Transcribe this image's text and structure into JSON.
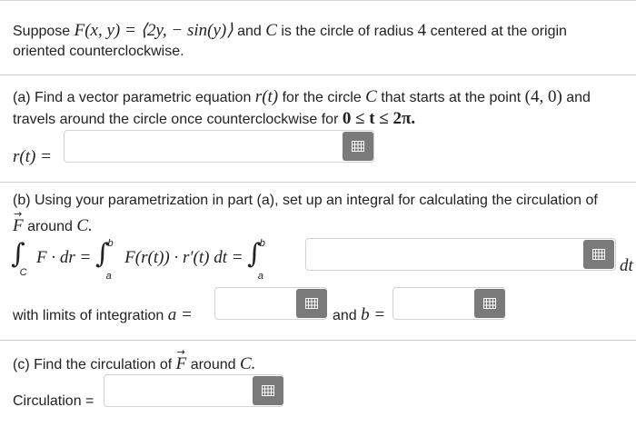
{
  "problem": {
    "intro_1": "Suppose",
    "field_expr": "F(x, y) = ⟨2y, − sin(y)⟩",
    "intro_2": "and",
    "curve": "C",
    "intro_3": "is the circle of radius",
    "radius": "4",
    "intro_4": "centered at the origin",
    "intro_line2": "oriented counterclockwise."
  },
  "part_a": {
    "text_1": "(a) Find a vector parametric equation",
    "r_t": "r(t)",
    "text_2": "for the circle",
    "text_3": "that starts at the point",
    "point": "(4, 0)",
    "text_4": "and",
    "line2": "travels around the circle once counterclockwise for",
    "range": "0 ≤ t ≤ 2π.",
    "label": "r(t) =",
    "answer_value": ""
  },
  "part_b": {
    "text_1": "(b) Using your parametrization in part (a), set up an integral for calculating the circulation of",
    "line2_suffix": "around",
    "line2_end": "C.",
    "integral_lhs": "F · dr =",
    "integral_mid": "F(r(t)) · r′(t) dt =",
    "lower_c": "C",
    "lower_a": "a",
    "upper_b": "b",
    "dt": "dt",
    "integrand_value": "",
    "limits_text": "with limits of integration",
    "a_label": "a =",
    "a_value": "",
    "and_text": "and",
    "b_label": "b =",
    "b_value": ""
  },
  "part_c": {
    "text_1": "(c) Find the circulation of",
    "text_2": "around",
    "text_3": "C.",
    "label": "Circulation =",
    "value": ""
  },
  "icons": {
    "keyboard": "keyboard-grid-icon"
  }
}
